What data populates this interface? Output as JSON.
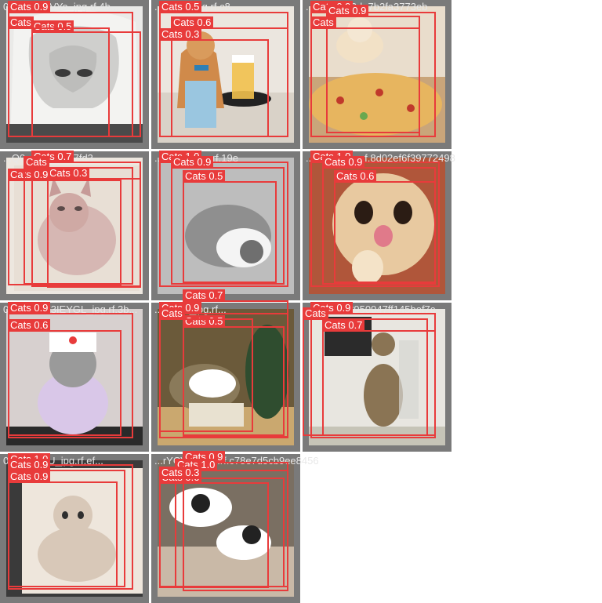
{
  "tiles": [
    {
      "name": "073",
      "filename": "073_...JkzVYo_jpg.rf.4b...",
      "bg": "#8e8e8e",
      "scene": [
        "#f0f0ef",
        "#d8d8d6",
        "#bdbdbb",
        "#4a4a4a"
      ],
      "boxes": [
        {
          "label": "Cats 0.9"
        },
        {
          "label": "Cats 0.5"
        },
        {
          "label": "Cats"
        }
      ]
    },
    {
      "name": "cat-beer",
      "filename": "...mKiQ_jpg.rf.c8...",
      "bg": "#7a7a7a",
      "scene": [
        "#e9e3dc",
        "#d08a4a",
        "#7fb7d6",
        "#f2c14e"
      ],
      "boxes": [
        {
          "label": "Cats 0.5"
        },
        {
          "label": "Cats 0.6"
        },
        {
          "label": "Cats 0.3"
        }
      ]
    },
    {
      "name": "cat-pizza",
      "filename": "...jpg.rf.782da7b2fa3773eb",
      "bg": "#7a7a7a",
      "scene": [
        "#c9a57a",
        "#f2e1c6",
        "#e7b55f",
        "#c0392b"
      ],
      "boxes": [
        {
          "label": "Cats 0.9"
        },
        {
          "label": "Cats 0.9"
        },
        {
          "label": "Cats"
        }
      ]
    },
    {
      "name": "sphynx",
      "filename": "...Q0e98_jpg.rf.7fd3",
      "bg": "#7a7a7a",
      "scene": [
        "#e8e1d8",
        "#d6b7b3",
        "#c69b98",
        "#8a6a68"
      ],
      "boxes": [
        {
          "label": "Cats 0.7"
        },
        {
          "label": "Cats 0.3"
        },
        {
          "label": "Cats 0.9"
        },
        {
          "label": "Cats"
        }
      ]
    },
    {
      "name": "grey-cat",
      "filename": "...bbtv0l_jpg.rf.19e",
      "bg": "#7a7a7a",
      "scene": [
        "#bfbfbf",
        "#a8a8a8",
        "#6f6f6f",
        "#f4f4f4"
      ],
      "boxes": [
        {
          "label": "Cats 1.0"
        },
        {
          "label": "Cats 0.9"
        },
        {
          "label": "Cats 0.5"
        }
      ]
    },
    {
      "name": "cat-tongue",
      "filename": "...TYEk_jpg.rf.8d02ef6f39772498",
      "bg": "#7a7a7a",
      "scene": [
        "#b0563a",
        "#e8c9a0",
        "#f4e3c8",
        "#e07a8a"
      ],
      "boxes": [
        {
          "label": "Cats 1.0"
        },
        {
          "label": "Cats 0.9"
        },
        {
          "label": "Cats 0.6"
        }
      ]
    },
    {
      "name": "nurse-cat",
      "filename": "0c...12nb73IEYGL_jpg.rf.3b...",
      "bg": "#7a7a7a",
      "scene": [
        "#3a3a3a",
        "#d9c7e8",
        "#9a9a9a",
        "#ffffff"
      ],
      "boxes": [
        {
          "label": "Cats 0.9"
        },
        {
          "label": "Cats 0.6"
        }
      ]
    },
    {
      "name": "catnip-box",
      "filename": "...UGp4_jpg.rf...",
      "bg": "#7a7a7a",
      "scene": [
        "#6b5a3a",
        "#caa86f",
        "#ffffff",
        "#2f4d2f"
      ],
      "boxes": [
        {
          "label": "Cats 0.7"
        },
        {
          "label": "Cats 0.9"
        },
        {
          "label": "Cats 0.5"
        },
        {
          "label": "Cats"
        }
      ]
    },
    {
      "name": "tabby-vase",
      "filename": "...jpg.rf.9f8950947ff145bef7c",
      "bg": "#7a7a7a",
      "scene": [
        "#2b2b2b",
        "#e8e6e0",
        "#8a7454",
        "#c6c4b7"
      ],
      "boxes": [
        {
          "label": "Cats 0.9"
        },
        {
          "label": "Cats 0.7"
        },
        {
          "label": "Cats"
        }
      ]
    },
    {
      "name": "curly-kitten",
      "filename": "08...sSldyU_jpg.rf.ef...",
      "bg": "#7a7a7a",
      "scene": [
        "#2e2e2e",
        "#eee6dc",
        "#d8c8b8",
        "#bfa896"
      ],
      "boxes": [
        {
          "label": "Cats 1.0"
        },
        {
          "label": "Cats 0.9"
        },
        {
          "label": "Cats 0.9"
        }
      ]
    },
    {
      "name": "two-cats",
      "filename": "...rYCVvg_jpg.rf.c78e7d5cb9ee8456",
      "bg": "#7a7a7a",
      "scene": [
        "#7a6f62",
        "#ffffff",
        "#222222",
        "#c9b9a7"
      ],
      "boxes": [
        {
          "label": "Cats 0.9"
        },
        {
          "label": "Cats 1.0"
        },
        {
          "label": "Cats 0.6"
        },
        {
          "label": "Cats 0.3"
        }
      ]
    }
  ]
}
